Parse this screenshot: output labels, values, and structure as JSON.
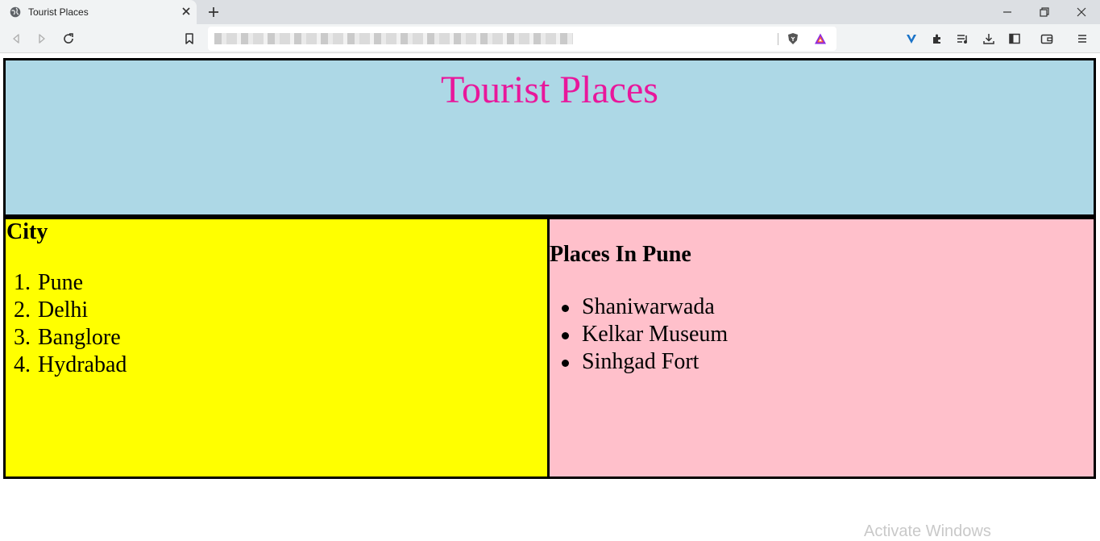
{
  "browser": {
    "tab_title": "Tourist Places",
    "colors": {
      "tab_bar": "#dcdfe3",
      "toolbar": "#f1f3f4"
    },
    "icons": [
      "globe-icon",
      "close-icon",
      "plus-icon",
      "minimize-icon",
      "restore-icon",
      "back-icon",
      "forward-icon",
      "reload-icon",
      "bookmark-icon",
      "brave-shield-icon",
      "brave-rewards-icon",
      "vpn-icon",
      "extensions-icon",
      "playlist-icon",
      "download-icon",
      "sidebar-icon",
      "wallet-icon",
      "menu-icon"
    ]
  },
  "page": {
    "title": "Tourist Places",
    "colors": {
      "header_bg": "#add8e6",
      "title_color": "#e8179b",
      "left_bg": "#ffff00",
      "right_bg": "#ffc0cb",
      "border": "#000000"
    },
    "city_section": {
      "heading": "City",
      "items": [
        {
          "num": "1.",
          "label": "Pune"
        },
        {
          "num": "2.",
          "label": "Delhi"
        },
        {
          "num": "3.",
          "label": "Banglore"
        },
        {
          "num": "4.",
          "label": "Hydrabad"
        }
      ]
    },
    "places_section": {
      "heading": "Places In Pune",
      "items": [
        "Shaniwarwada",
        "Kelkar Museum",
        "Sinhgad Fort"
      ]
    }
  },
  "overlay": {
    "activate_windows": "Activate Windows"
  }
}
